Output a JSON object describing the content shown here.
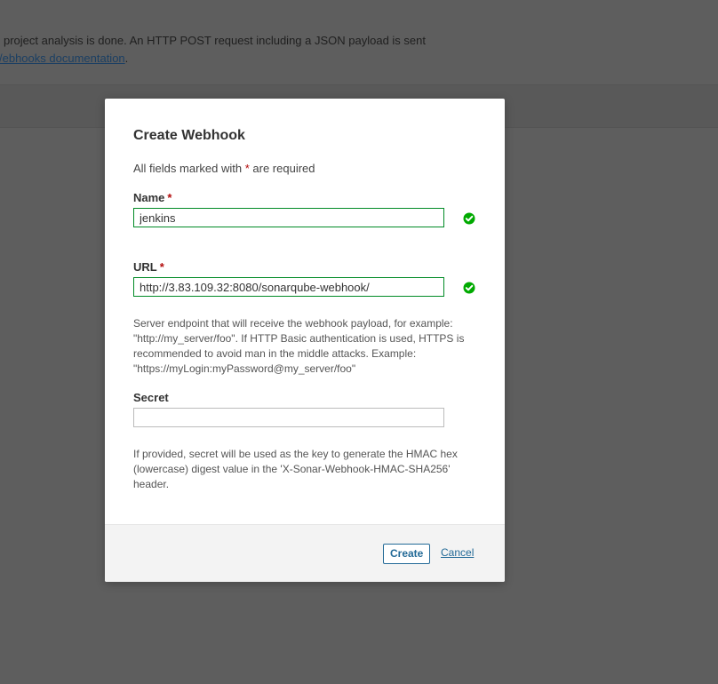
{
  "background": {
    "description_line1": "project analysis is done. An HTTP POST request including a JSON payload is sent",
    "description_line2_link": "/ebhooks documentation",
    "description_line2_suffix": "."
  },
  "modal": {
    "title": "Create Webhook",
    "required_note_prefix": "All fields marked with ",
    "required_star": "*",
    "required_note_suffix": " are required",
    "fields": {
      "name": {
        "label": "Name",
        "value": "jenkins",
        "valid": true
      },
      "url": {
        "label": "URL",
        "value": "http://3.83.109.32:8080/sonarqube-webhook/",
        "valid": true,
        "help": "Server endpoint that will receive the webhook payload, for example: \"http://my_server/foo\". If HTTP Basic authentication is used, HTTPS is recommended to avoid man in the middle attacks. Example: \"https://myLogin:myPassword@my_server/foo\""
      },
      "secret": {
        "label": "Secret",
        "value": "",
        "help": "If provided, secret will be used as the key to generate the HMAC hex (lowercase) digest value in the 'X-Sonar-Webhook-HMAC-SHA256' header."
      }
    },
    "footer": {
      "create_label": "Create",
      "cancel_label": "Cancel"
    }
  },
  "colors": {
    "valid": "#00aa00",
    "required_star": "#b30c0c",
    "link": "#236a97",
    "overlay": "#5e5e5e"
  },
  "icons": {
    "valid": "check-circle-icon"
  }
}
